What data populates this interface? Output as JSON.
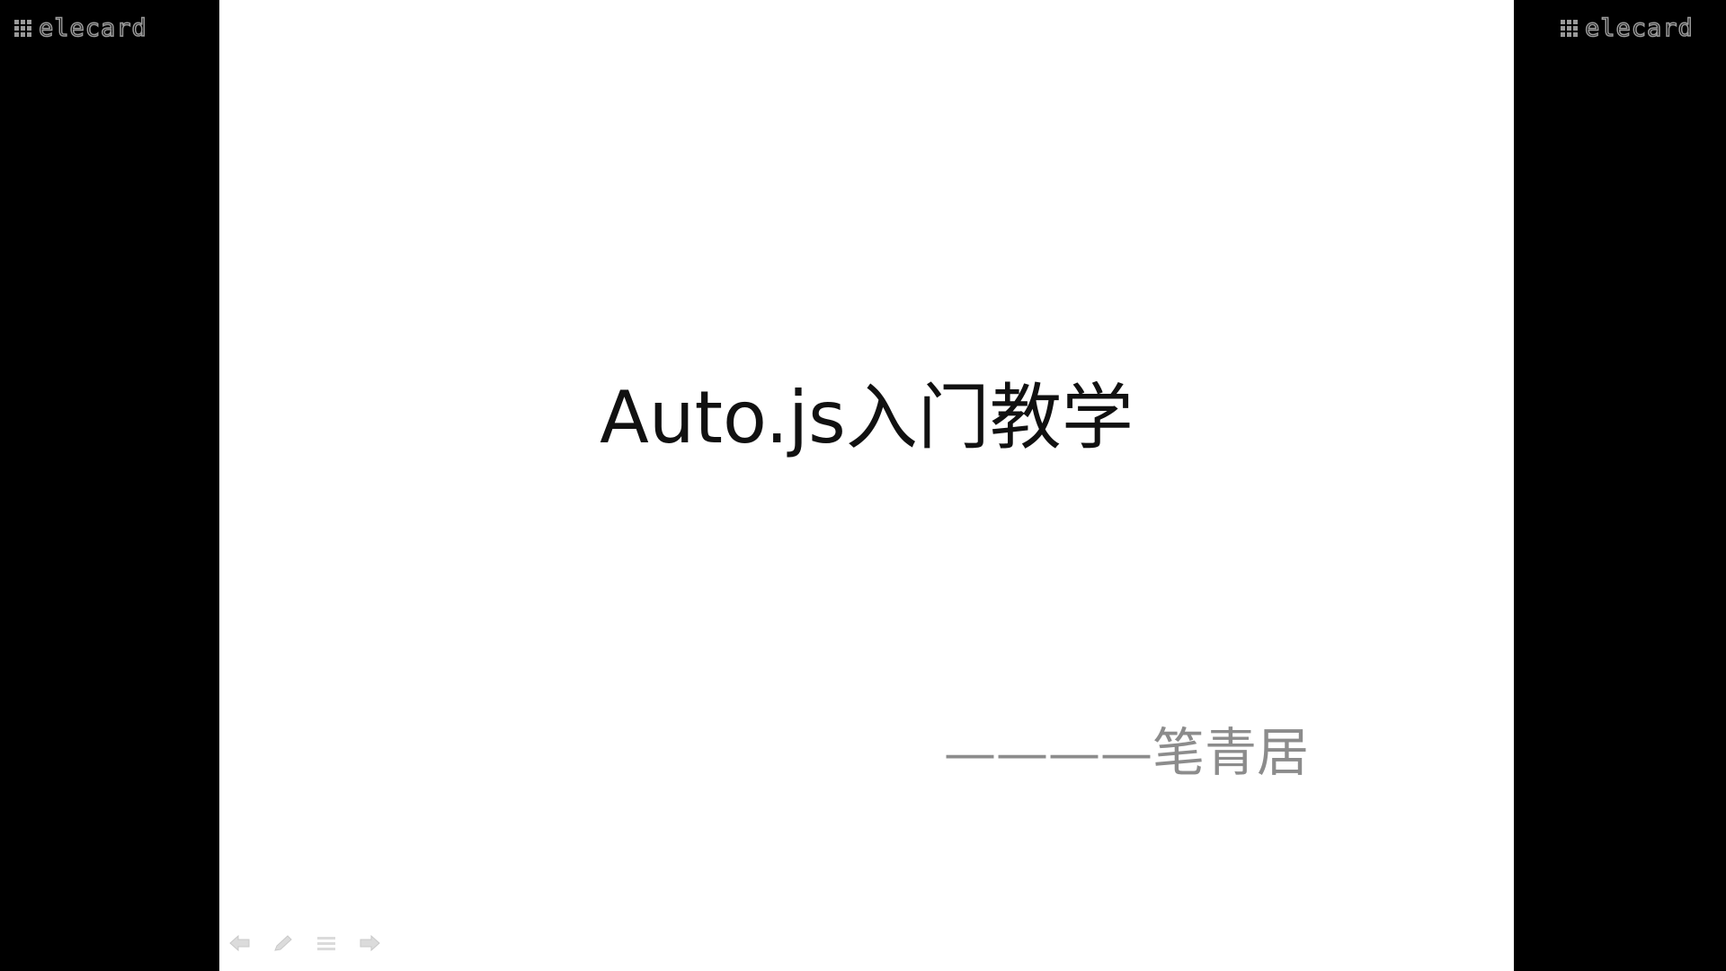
{
  "watermark": {
    "text": "elecard",
    "color": "#9a9a9a"
  },
  "slide": {
    "background": "#ffffff",
    "title": "Auto.js入门教学",
    "subtitle": "————笔青居"
  },
  "controls": {
    "icons": [
      "arrow-left-icon",
      "pen-icon",
      "menu-icon",
      "arrow-right-icon"
    ]
  }
}
